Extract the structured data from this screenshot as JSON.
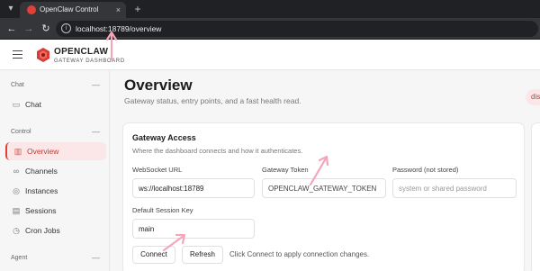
{
  "browser": {
    "tab_title": "OpenClaw Control",
    "tab_close": "×",
    "new_tab": "+",
    "url": "localhost:18789/overview"
  },
  "header": {
    "brand_name": "OPENCLAW",
    "brand_subtitle": "GATEWAY DASHBOARD"
  },
  "sidebar": {
    "sections": [
      {
        "label": "Chat"
      },
      {
        "label": "Control"
      },
      {
        "label": "Agent"
      }
    ],
    "items": [
      {
        "label": "Chat",
        "icon": "chat-bubble-icon"
      },
      {
        "label": "Overview",
        "icon": "bar-chart-icon"
      },
      {
        "label": "Channels",
        "icon": "link-icon"
      },
      {
        "label": "Instances",
        "icon": "broadcast-icon"
      },
      {
        "label": "Sessions",
        "icon": "document-icon"
      },
      {
        "label": "Cron Jobs",
        "icon": "clock-icon"
      }
    ],
    "toggle": "—"
  },
  "main": {
    "title": "Overview",
    "subtitle": "Gateway status, entry points, and a fast health read.",
    "status_pill": "dis"
  },
  "gateway_access": {
    "title": "Gateway Access",
    "description": "Where the dashboard connects and how it authenticates.",
    "websocket_label": "WebSocket URL",
    "websocket_value": "ws://localhost:18789",
    "token_label": "Gateway Token",
    "token_value": "OPENCLAW_GATEWAY_TOKEN",
    "password_label": "Password (not stored)",
    "password_placeholder": "system or shared password",
    "session_label": "Default Session Key",
    "session_value": "main",
    "connect_label": "Connect",
    "refresh_label": "Refresh",
    "hint": "Click Connect to apply connection changes."
  },
  "colors": {
    "accent": "#e0403a",
    "active_bg": "#fbe7e7",
    "annotation": "#f4a6b8"
  }
}
